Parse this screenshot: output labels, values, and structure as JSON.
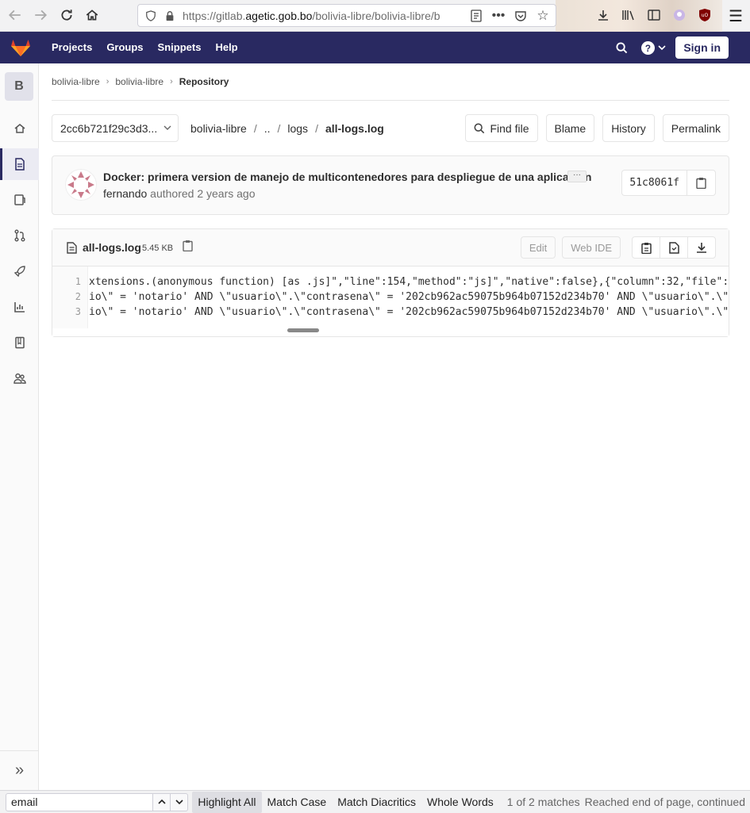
{
  "browser": {
    "url_prefix": "https://gitlab.",
    "url_domain": "agetic.gob.bo",
    "url_path": "/bolivia-libre/bolivia-libre/b"
  },
  "header": {
    "nav": [
      "Projects",
      "Groups",
      "Snippets",
      "Help"
    ],
    "sign_in": "Sign in",
    "logo_color": "#fc6d26",
    "bg_color": "#292961"
  },
  "sidebar": {
    "project_letter": "B",
    "items": [
      "home-icon",
      "file-icon",
      "issues-icon",
      "merge-request-icon",
      "rocket-icon",
      "chart-icon",
      "book-icon",
      "members-icon"
    ]
  },
  "breadcrumb": {
    "items": [
      "bolivia-libre",
      "bolivia-libre",
      "Repository"
    ]
  },
  "tree": {
    "ref": "2cc6b721f29c3d3...",
    "path": [
      "bolivia-libre",
      "..",
      "logs"
    ],
    "file": "all-logs.log",
    "buttons": {
      "find_file": "Find file",
      "blame": "Blame",
      "history": "History",
      "permalink": "Permalink"
    }
  },
  "commit": {
    "title": "Docker: primera version de manejo de multicontenedores para despliegue de una aplicacion",
    "author": "fernando",
    "authored": "authored",
    "time": "2 years ago",
    "sha": "51c8061f",
    "more": "···"
  },
  "file": {
    "name": "all-logs.log",
    "size": "5.45 KB",
    "edit": "Edit",
    "web_ide": "Web IDE",
    "lines": [
      {
        "n": "1",
        "text": "xtensions.(anonymous function) [as .js]\",\"line\":154,\"method\":\"js]\",\"native\":false},{\"column\":32,\"file\":"
      },
      {
        "n": "2",
        "text": "io\\\" = 'notario' AND \\\"usuario\\\".\\\"contrasena\\\" = '202cb962ac59075b964b07152d234b70' AND \\\"usuario\\\".\\\""
      },
      {
        "n": "3",
        "text": "io\\\" = 'notario' AND \\\"usuario\\\".\\\"contrasena\\\" = '202cb962ac59075b964b07152d234b70' AND \\\"usuario\\\".\\\""
      }
    ]
  },
  "findbar": {
    "query": "email",
    "highlight_all": "Highlight All",
    "match_case": "Match Case",
    "match_diacritics": "Match Diacritics",
    "whole_words": "Whole Words",
    "matches": "1 of 2 matches",
    "status": "Reached end of page, continued"
  }
}
